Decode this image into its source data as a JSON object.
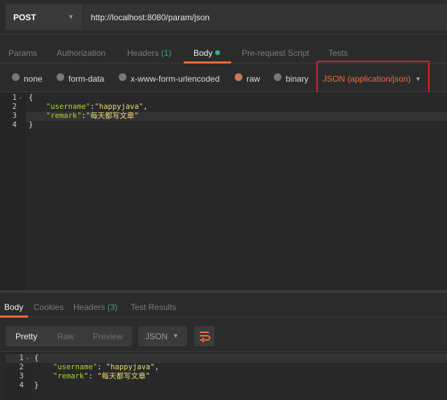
{
  "request": {
    "method": "POST",
    "url": "http://localhost:8080/param/json"
  },
  "request_tabs": [
    {
      "label": "Params"
    },
    {
      "label": "Authorization"
    },
    {
      "label": "Headers",
      "count": "(1)"
    },
    {
      "label": "Body"
    },
    {
      "label": "Pre-request Script"
    },
    {
      "label": "Tests"
    }
  ],
  "body_modes": [
    "none",
    "form-data",
    "x-www-form-urlencoded",
    "raw",
    "binary"
  ],
  "selected_mode": "raw",
  "content_type": "JSON (application/json)",
  "request_body": {
    "line_numbers": [
      "1",
      "2",
      "3",
      "4"
    ],
    "lines": [
      "{",
      "\"username\"",
      ":",
      "\"happyjava\"",
      ",",
      "\"remark\"",
      ":",
      "\"每天都写文章\"",
      "}"
    ]
  },
  "response_tabs": [
    {
      "label": "Body"
    },
    {
      "label": "Cookies"
    },
    {
      "label": "Headers",
      "count": "(3)"
    },
    {
      "label": "Test Results"
    }
  ],
  "view_modes": [
    "Pretty",
    "Raw",
    "Preview"
  ],
  "format": "JSON",
  "response_body": {
    "line_numbers": [
      "1",
      "2",
      "3",
      "4"
    ],
    "open": "{",
    "k1": "\"username\"",
    "v1": "\"happyjava\"",
    "k2": "\"remark\"",
    "v2": "\"每天都写文章\"",
    "close": "}"
  },
  "colors": {
    "accent": "#f26b3a",
    "highlight_box": "#e0201b",
    "key": "#a6d62e",
    "string": "#e6db74"
  }
}
